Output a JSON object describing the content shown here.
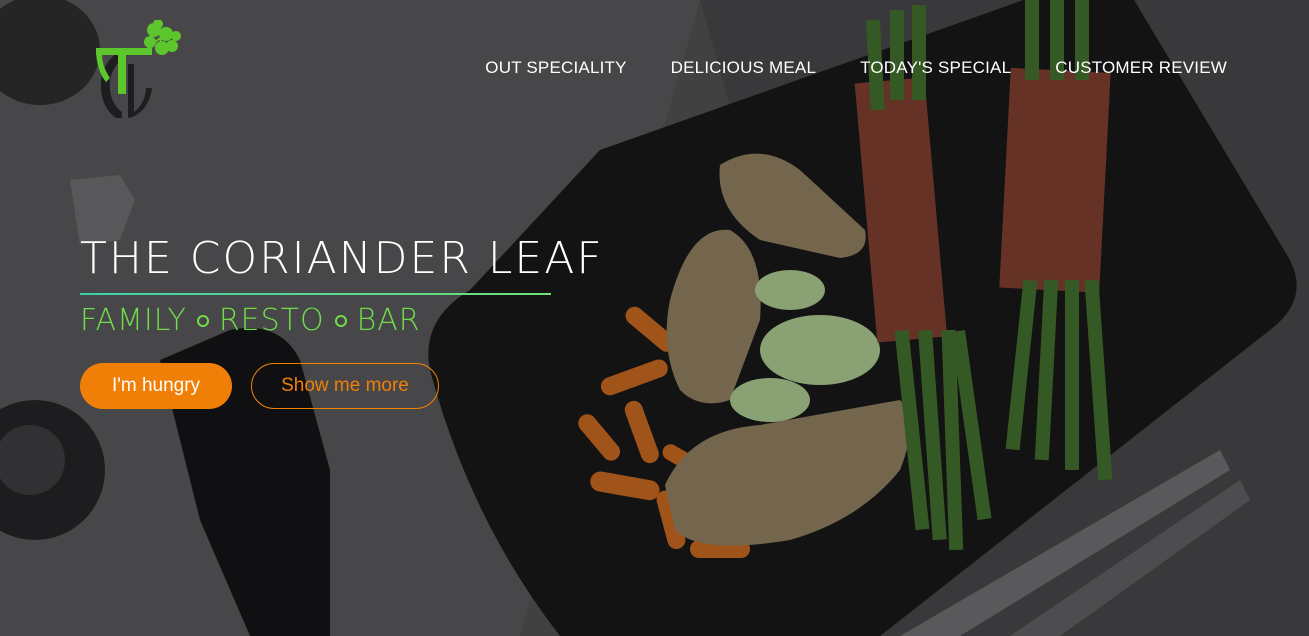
{
  "brand": {
    "logo_icon": "coriander-leaf-logo"
  },
  "nav": {
    "items": [
      {
        "label": "OUT SPECIALITY"
      },
      {
        "label": "DELICIOUS MEAL"
      },
      {
        "label": "TODAY'S SPECIAL"
      },
      {
        "label": "CUSTOMER REVIEW"
      }
    ]
  },
  "hero": {
    "title": "THE CORIANDER LEAF",
    "tagline": [
      "FAMILY",
      "RESTO",
      "BAR"
    ],
    "primary_button": "I'm hungry",
    "secondary_button": "Show me more"
  },
  "colors": {
    "accent": "#f07f08",
    "green": "#6fdc4a",
    "teal": "#3fd0a8",
    "text": "#ffffff"
  }
}
